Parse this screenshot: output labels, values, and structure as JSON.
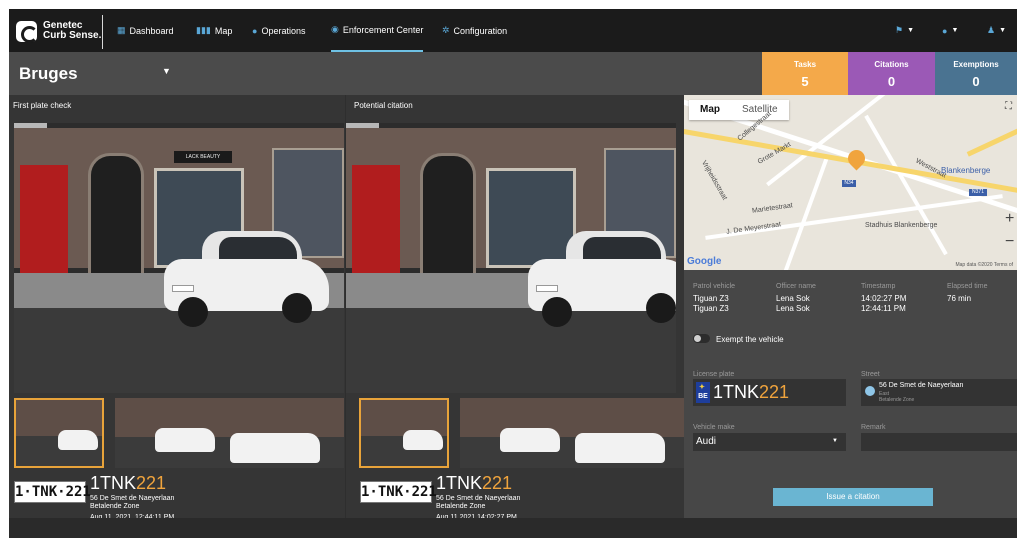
{
  "brand": {
    "line1": "Genetec",
    "line2": "Curb Sense."
  },
  "nav": {
    "items": [
      {
        "label": "Dashboard",
        "icon": "dashboard-icon"
      },
      {
        "label": "Map",
        "icon": "map-icon"
      },
      {
        "label": "Operations",
        "icon": "operations-icon"
      },
      {
        "label": "Enforcement Center",
        "icon": "enforcement-icon"
      },
      {
        "label": "Configuration",
        "icon": "gear-icon"
      }
    ]
  },
  "header": {
    "city": "Bruges"
  },
  "stats": {
    "tasks": {
      "label": "Tasks",
      "value": "5",
      "color": "#f4a94a"
    },
    "citations": {
      "label": "Citations",
      "value": "0",
      "color": "#9b59b6"
    },
    "exemptions": {
      "label": "Exemptions",
      "value": "0",
      "color": "#4a7391"
    }
  },
  "panels": {
    "first": {
      "title": "First plate check",
      "plate_img": "1·TNK·221",
      "plate_prefix": "1",
      "plate_mid": "TNK",
      "plate_suffix": "221",
      "address": "56 De Smet de Naeyerlaan",
      "zone": "Betalende Zone",
      "time": "Aug 11, 2021, 12:44:11 PM",
      "shop_sign": "LACK BEAUTY"
    },
    "second": {
      "title": "Potential citation",
      "plate_img": "1·TNK·221",
      "plate_prefix": "1",
      "plate_mid": "TNK",
      "plate_suffix": "221",
      "address": "56 De Smet de Naeyerlaan",
      "zone": "Betalende Zone",
      "time": "Aug 11,2021,14:02:27 PM"
    }
  },
  "map": {
    "tab_map": "Map",
    "tab_satellite": "Satellite",
    "road_tag": "N34",
    "road_tag2": "N371",
    "labels": {
      "blankenberge": "Blankenberge",
      "stadhuis": "Stadhuis Blankenberge",
      "vrijheidsstraat": "Vrijheidsstraat",
      "marietestraat": "Marietestraat",
      "meyerstraat": "J. De Meyerstraat",
      "grotestraat": "Grote Markt",
      "collegestraat": "Collegestraat",
      "weststraat": "Weststraat"
    },
    "google": "Google",
    "map_data": "Map data ©2020",
    "terms": "Terms of"
  },
  "details": {
    "patrol_label": "Patrol vehicle",
    "officer_label": "Officer name",
    "timestamp_label": "Timestamp",
    "elapsed_label": "Elapsed time",
    "patrol_1": "Tiguan Z3",
    "patrol_2": "Tiguan Z3",
    "officer_1": "Lena Sok",
    "officer_2": "Lena Sok",
    "ts_1": "14:02:27 PM",
    "ts_2": "12:44:11 PM",
    "elapsed": "76 min",
    "exempt_label": "Exempt the vehicle",
    "license_label": "License plate",
    "country": "BE",
    "lp_prefix": "1",
    "lp_mid": "TNK",
    "lp_suffix": "221",
    "street_label": "Street",
    "street_value": "56 De Smet de Naeyerlaan",
    "street_sub1": "East",
    "street_sub2": "Betalende Zone",
    "make_label": "Vehicle make",
    "make_value": "Audi",
    "remark_label": "Remark",
    "issue_button": "Issue a citation"
  }
}
